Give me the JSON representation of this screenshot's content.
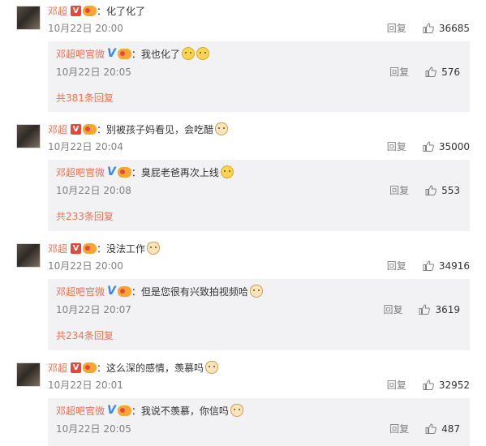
{
  "labels": {
    "reply": "回复"
  },
  "comments": [
    {
      "user": "邓超",
      "text": "化了化了",
      "time": "10月22日 20:00",
      "likes": "36685",
      "emoji": "none",
      "reply": {
        "user": "邓超吧官微",
        "text": "我也化了",
        "time": "10月22日 20:05",
        "likes": "576",
        "emoji": "melting-face-x2"
      },
      "more": "共381条回复"
    },
    {
      "user": "邓超",
      "text": "别被孩子妈看见，会吃醋",
      "time": "10月22日 20:04",
      "likes": "35000",
      "emoji": "doge",
      "reply": {
        "user": "邓超吧官微",
        "text": "臭屁老爸再次上线",
        "time": "10月22日 20:08",
        "likes": "553",
        "emoji": "smirk-face"
      },
      "more": "共233条回复"
    },
    {
      "user": "邓超",
      "text": "没法工作",
      "time": "10月22日 20:00",
      "likes": "34916",
      "emoji": "doge",
      "reply": {
        "user": "邓超吧官微",
        "text": "但是您很有兴致拍视频哈",
        "time": "10月22日 20:07",
        "likes": "3619",
        "emoji": "doge"
      },
      "more": "共234条回复"
    },
    {
      "user": "邓超",
      "text": "这么深的感情，羡慕吗",
      "time": "10月22日 20:01",
      "likes": "32952",
      "emoji": "doge",
      "reply": {
        "user": "邓超吧官微",
        "text": "我说不羡慕，你信吗",
        "time": "10月22日 20:05",
        "likes": "487",
        "emoji": "doge"
      },
      "more": ""
    }
  ],
  "colors": {
    "username": "#eb7350",
    "subbox_bg": "#f2f2f5",
    "meta_gray": "#808080",
    "text": "#333333"
  }
}
